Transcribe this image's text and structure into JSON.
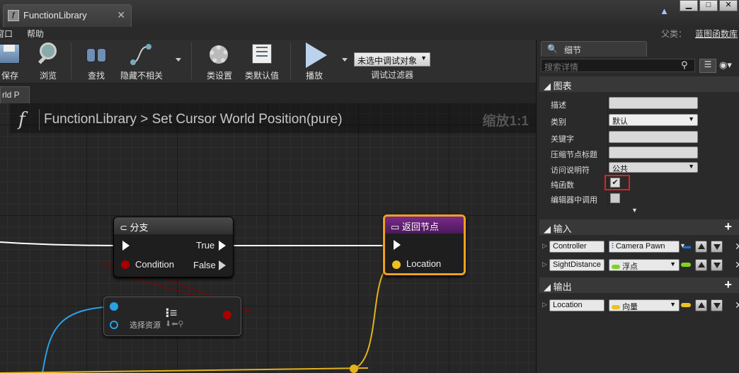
{
  "window": {
    "tab_title": "FunctionLibrary",
    "tab_icon": "blueprint-icon",
    "controls": [
      "▁",
      "□",
      "✕"
    ]
  },
  "menu": {
    "items": [
      "窗口",
      "帮助"
    ],
    "parent_label": "父类：",
    "parent_value": "蓝图函数库"
  },
  "toolbar": {
    "save": "保存",
    "browse": "浏览",
    "find": "查找",
    "hide_unrelated": "隐藏不相关",
    "class_settings": "类设置",
    "class_defaults": "类默认值",
    "play": "播放",
    "debug_select": "未选中调试对象",
    "debug_filter": "调试过滤器"
  },
  "graph": {
    "tab_label": "rld P",
    "breadcrumb_root": "FunctionLibrary",
    "breadcrumb_sep": ">",
    "breadcrumb_func": "Set Cursor World Position(pure)",
    "zoom": "缩放1:1",
    "nodes": {
      "branch": {
        "title": "分支",
        "true_pin": "True",
        "false_pin": "False",
        "condition_pin": "Condition"
      },
      "return": {
        "title": "返回节点",
        "location_pin": "Location"
      },
      "select": {
        "label": "选择资源"
      }
    }
  },
  "panel": {
    "tab_title": "细节",
    "search_placeholder": "搜索详情",
    "graph_section": "图表",
    "props": {
      "description_label": "描述",
      "category_label": "类别",
      "category_value": "默认",
      "keywords_label": "关键字",
      "compact_title_label": "压缩节点标题",
      "access_label": "访问说明符",
      "access_value": "公共",
      "pure_label": "纯函数",
      "pure_checked": true,
      "call_in_editor_label": "编辑器中调用",
      "call_in_editor_checked": false
    },
    "inputs_section": "输入",
    "inputs": [
      {
        "name": "Controller",
        "type": "Camera Pawn"
      },
      {
        "name": "SightDistance",
        "type": "浮点"
      }
    ],
    "outputs_section": "输出",
    "outputs": [
      {
        "name": "Location",
        "type": "向量"
      }
    ]
  }
}
